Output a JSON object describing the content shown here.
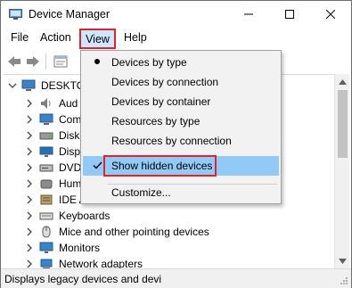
{
  "window": {
    "title": "Device Manager",
    "controls": [
      "minimize",
      "maximize",
      "close"
    ]
  },
  "menubar": {
    "file": "File",
    "action": "Action",
    "view": "View",
    "help": "Help"
  },
  "toolbar": {
    "icons": [
      "back-arrow-icon",
      "forward-arrow-icon",
      "properties-icon"
    ]
  },
  "tree": {
    "root_label": "DESKTO",
    "items": [
      {
        "label": "Aud",
        "icon": "audio-icon"
      },
      {
        "label": "Com",
        "icon": "computer-icon"
      },
      {
        "label": "Disk",
        "icon": "disk-drive-icon"
      },
      {
        "label": "Disp",
        "icon": "display-icon"
      },
      {
        "label": "DVD",
        "icon": "dvd-icon"
      },
      {
        "label": "Hum",
        "icon": "hid-icon"
      },
      {
        "label": "IDE A",
        "icon": "ide-icon"
      },
      {
        "label": "Keyboards",
        "icon": "keyboard-icon"
      },
      {
        "label": "Mice and other pointing devices",
        "icon": "mouse-icon"
      },
      {
        "label": "Monitors",
        "icon": "monitor-icon"
      },
      {
        "label": "Network adapters",
        "icon": "network-icon"
      }
    ]
  },
  "view_menu": {
    "items": [
      {
        "label": "Devices by type",
        "mark": "bullet"
      },
      {
        "label": "Devices by connection",
        "mark": ""
      },
      {
        "label": "Devices by container",
        "mark": ""
      },
      {
        "label": "Resources by type",
        "mark": ""
      },
      {
        "label": "Resources by connection",
        "mark": ""
      },
      {
        "label": "Show hidden devices",
        "mark": "check",
        "highlighted": true
      },
      {
        "label": "Customize...",
        "mark": ""
      }
    ]
  },
  "statusbar": {
    "text": "Displays legacy devices and devi"
  },
  "colors": {
    "highlight": "#91c9f7",
    "annotation_red": "#e0242a",
    "menu_open_bg": "#cce8ff"
  }
}
